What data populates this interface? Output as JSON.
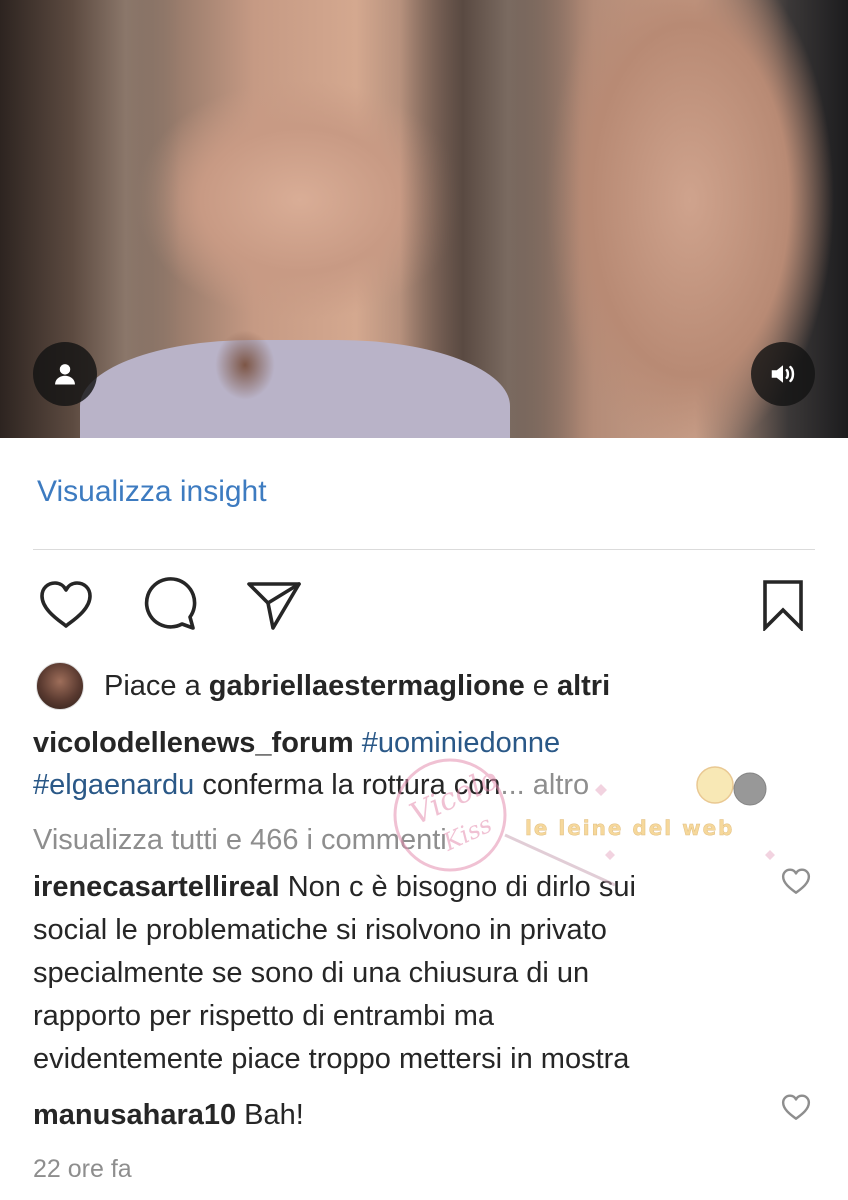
{
  "post": {
    "insights_link": "Visualizza insight",
    "likes": {
      "prefix": "Piace a ",
      "user": "gabriellaestermaglione",
      "middle": " e ",
      "others": "altri"
    },
    "caption": {
      "username": "vicolodellenews_forum",
      "hashtag1": "#uominiedonne",
      "hashtag2": "#elgaenardu",
      "text": " conferma la rottura con",
      "more": "... altro"
    },
    "view_comments": "Visualizza tutti e 466 i commenti",
    "comments": [
      {
        "username": "irenecasartellireal",
        "text_first": " Non c è bisogno di dirlo sui",
        "lines": [
          "social le problematiche si risolvono in privato",
          "specialmente se sono di una chiusura di un",
          "rapporto per rispetto di entrambi ma",
          "evidentemente piace troppo mettersi in mostra"
        ]
      },
      {
        "username": "manusahara10",
        "text": " Bah!"
      }
    ],
    "timestamp": "22 ore fa"
  },
  "watermark": {
    "left_text": "Vicolo delle Kiss",
    "right_text": "le leine del web"
  },
  "colors": {
    "link": "#3d7bc0",
    "hashtag": "#2a5887",
    "muted": "#8e8e8e",
    "text": "#262626"
  },
  "icons": [
    "user-icon",
    "volume-icon",
    "heart-icon",
    "comment-icon",
    "share-icon",
    "bookmark-icon",
    "small-heart-icon"
  ]
}
